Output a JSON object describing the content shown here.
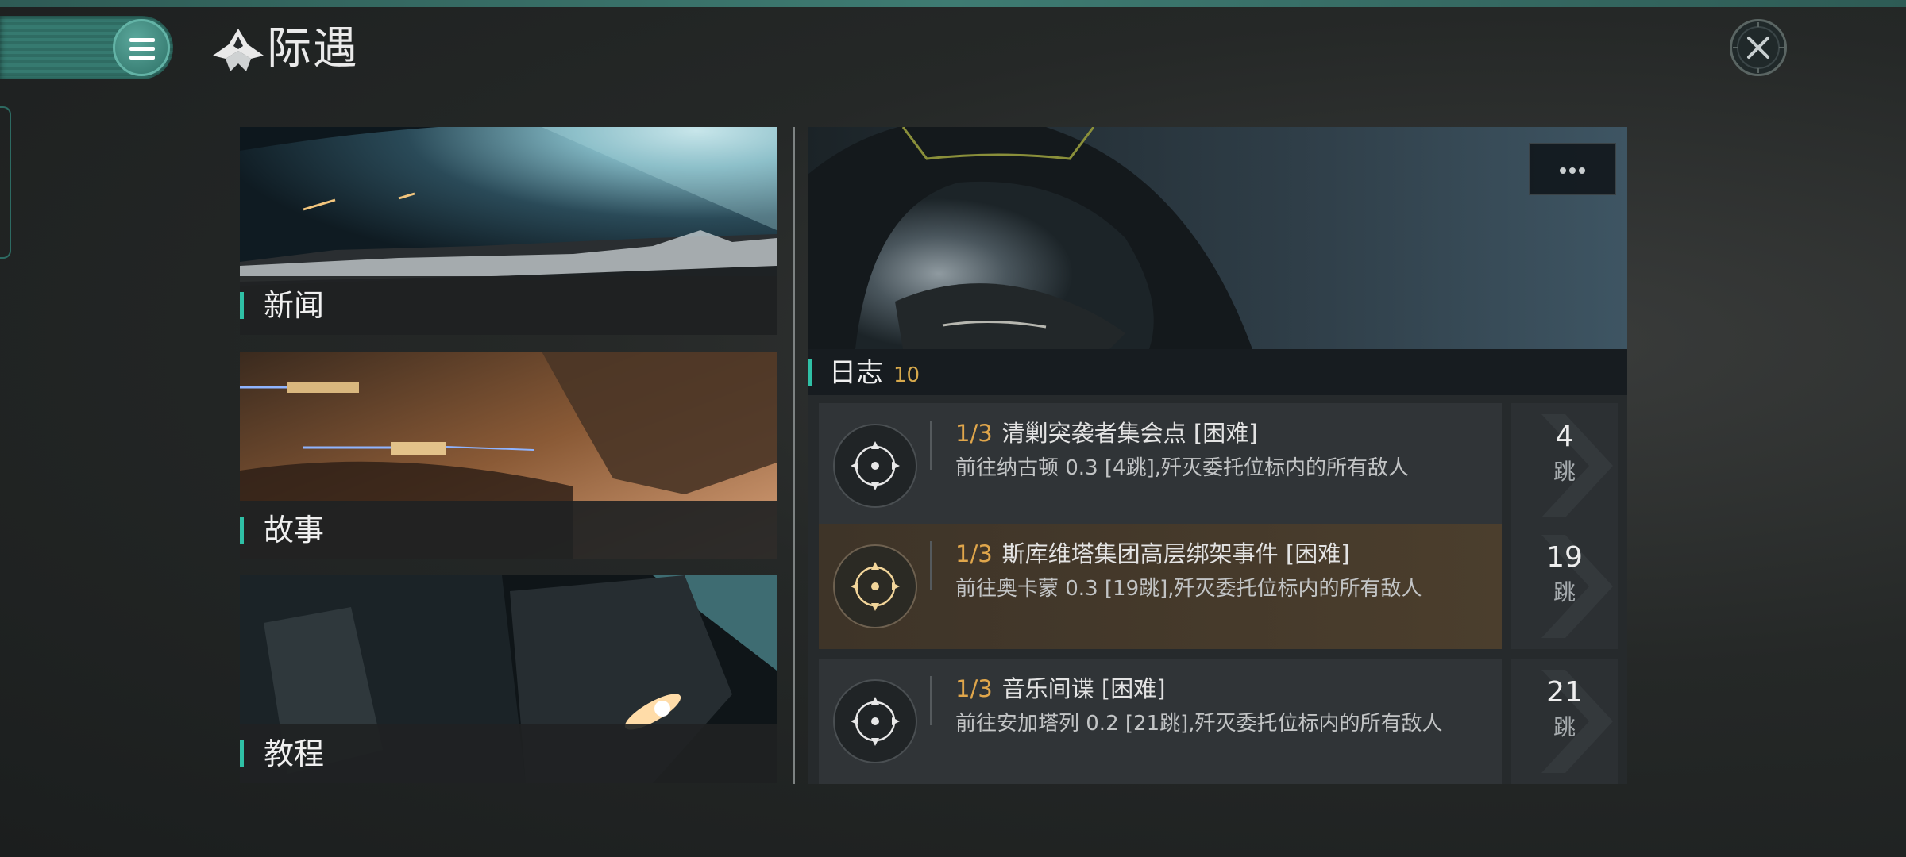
{
  "header": {
    "title": "际遇",
    "menu_icon": "hamburger-menu-icon",
    "brand_icon": "encounter-emblem-icon",
    "close_icon": "close-icon"
  },
  "cards": [
    {
      "label": "新闻",
      "art": "planet-horizon-with-ships"
    },
    {
      "label": "故事",
      "art": "ships-near-asteroid"
    },
    {
      "label": "教程",
      "art": "ship-hull-closeup"
    }
  ],
  "journal": {
    "label": "日志",
    "count": "10",
    "more_icon": "ellipsis-icon",
    "missions": [
      {
        "progress": "1/3",
        "title": "清剿突袭者集会点 [困难]",
        "desc": "前往纳古顿 0.3 [4跳],歼灭委托位标内的所有敌人",
        "jumps": "4",
        "jump_unit": "跳",
        "icon": "target-crosshair-icon"
      },
      {
        "progress": "1/3",
        "title": "斯库维塔集团高层绑架事件 [困难]",
        "desc": "前往奥卡蒙 0.3 [19跳],歼灭委托位标内的所有敌人",
        "jumps": "19",
        "jump_unit": "跳",
        "icon": "target-crosshair-icon"
      },
      {
        "progress": "1/3",
        "title": "音乐间谍 [困难]",
        "desc": "前往安加塔列 0.2 [21跳],歼灭委托位标内的所有敌人",
        "jumps": "21",
        "jump_unit": "跳",
        "icon": "target-crosshair-icon"
      }
    ]
  },
  "colors": {
    "accent": "#2fc0a6",
    "menu_teal": "#367a70",
    "progress_gold": "#e0a64b",
    "selected_row": "#4b3e2d"
  }
}
